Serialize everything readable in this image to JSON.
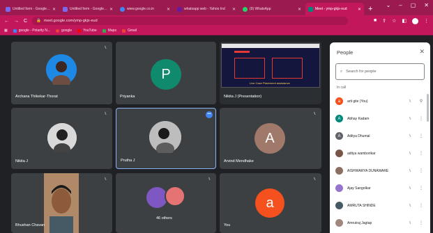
{
  "browser": {
    "tabs": [
      {
        "title": "Untitled form - Google Form",
        "favicon_color": "#7b68ee",
        "active": false
      },
      {
        "title": "Untitled form - Google Form",
        "favicon_color": "#7b68ee",
        "active": false
      },
      {
        "title": "www.google.co.in",
        "favicon_color": "#4285f4",
        "active": false
      },
      {
        "title": "whatsapp web - Yahoo Ind",
        "favicon_color": "#6a1b9a",
        "active": false
      },
      {
        "title": "(9) WhatsApp",
        "favicon_color": "#25d366",
        "active": false
      },
      {
        "title": "Meet - ymp-gkjx-eud",
        "favicon_color": "#00897b",
        "active": true
      }
    ],
    "new_tab": "+",
    "window_controls": [
      "⌄",
      "–",
      "▢",
      "✕"
    ],
    "url": "meet.google.com/ymp-gkjx-eud",
    "bookmarks": [
      {
        "label": "google - Polarity N...",
        "color": "#4285f4"
      },
      {
        "label": "google",
        "color": "#ea4335"
      },
      {
        "label": "YouTube",
        "color": "#ff0000"
      },
      {
        "label": "Maps",
        "color": "#34a853"
      },
      {
        "label": "Gmail",
        "color": "#ea4335"
      }
    ]
  },
  "tiles": {
    "t1": {
      "name": "Archana Thikekar-Thorat"
    },
    "t2": {
      "name": "Priyanka",
      "initial": "P",
      "color": "#0f8a6d"
    },
    "t3": {
      "name": "Nikita J (Presentation)",
      "slide_caption": "Live Case Placement assistance"
    },
    "t4": {
      "name": "Nikita J"
    },
    "t5": {
      "name": "Prutha J"
    },
    "t6": {
      "name": "Arvind Mendhake",
      "initial": "A",
      "color": "#a1796b"
    },
    "t7": {
      "name": "Bhushan Chavan"
    },
    "t8": {
      "name": "",
      "others": "46 others"
    },
    "t9": {
      "name": "You",
      "initial": "a",
      "color": "#f4511e"
    }
  },
  "people": {
    "title": "People",
    "search_placeholder": "Search for people",
    "section": "In call",
    "list": [
      {
        "name": "arti gite (You)",
        "initial": "a",
        "color": "#f4511e"
      },
      {
        "name": "Abhay Kadam",
        "initial": "A",
        "color": "#00897b"
      },
      {
        "name": "Aditya Dhumal",
        "initial": "A",
        "color": "#5f6368"
      },
      {
        "name": "aditya wamborikar",
        "initial": "",
        "color": "#795548"
      },
      {
        "name": "AISHWARYA DUNAWARE",
        "initial": "",
        "color": "#8d6e63"
      },
      {
        "name": "Ajay Sangolkar",
        "initial": "",
        "color": "#9575cd"
      },
      {
        "name": "AMRUTA SHINDE",
        "initial": "",
        "color": "#455a64"
      },
      {
        "name": "Amrutraj Jagtap",
        "initial": "",
        "color": "#a1887f"
      }
    ]
  }
}
